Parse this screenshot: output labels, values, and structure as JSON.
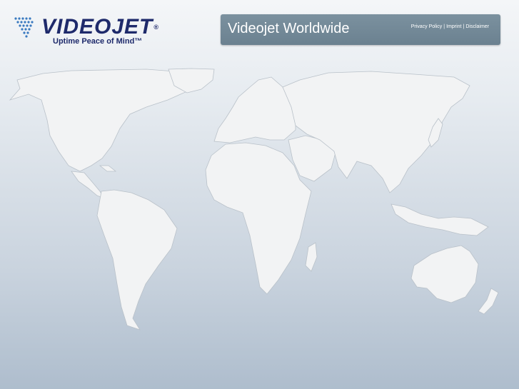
{
  "logo": {
    "wordmark": "VIDEOJET",
    "trademark": "®",
    "tagline": "Uptime Peace of Mind™",
    "colors": {
      "brand_blue": "#1e2a6b",
      "accent_blue": "#3a7ac0"
    }
  },
  "header": {
    "title": "Videojet Worldwide",
    "links": [
      {
        "label": "Privacy Policy"
      },
      {
        "label": "Imprint"
      },
      {
        "label": "Disclaimer"
      }
    ],
    "separator": "|",
    "background_color": "#72899a"
  },
  "map": {
    "regions": [
      "north-america",
      "greenland",
      "central-america",
      "south-america",
      "europe",
      "africa",
      "madagascar",
      "middle-east",
      "asia",
      "japan",
      "indonesia",
      "australia",
      "new-zealand"
    ],
    "land_color": "#f2f3f4",
    "border_color": "#b9c1c9"
  }
}
